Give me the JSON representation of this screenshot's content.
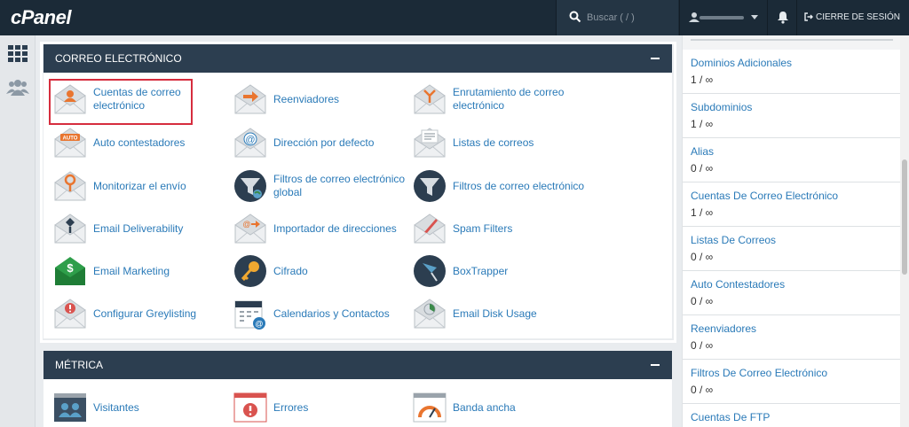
{
  "topbar": {
    "logo": "cPanel",
    "search_placeholder": "Buscar ( / )",
    "logout_label": "CIERRE DE SESIÓN"
  },
  "email_section": {
    "title": "CORREO ELECTRÓNICO",
    "items": [
      {
        "label_lines": [
          "Cuentas de correo",
          "electrónico"
        ],
        "icon": "email-accounts-icon"
      },
      {
        "label_lines": [
          "Reenviadores"
        ],
        "icon": "forwarders-icon"
      },
      {
        "label_lines": [
          "Enrutamiento de correo",
          "electrónico"
        ],
        "icon": "email-routing-icon"
      },
      {
        "label_lines": [
          "Auto contestadores"
        ],
        "icon": "autoresponders-icon"
      },
      {
        "label_lines": [
          "Dirección por defecto"
        ],
        "icon": "default-address-icon"
      },
      {
        "label_lines": [
          "Listas de correos"
        ],
        "icon": "mailing-lists-icon"
      },
      {
        "label_lines": [
          "Monitorizar el envío"
        ],
        "icon": "track-delivery-icon"
      },
      {
        "label_lines": [
          "Filtros de correo electrónico",
          "global"
        ],
        "icon": "global-email-filters-icon"
      },
      {
        "label_lines": [
          "Filtros de correo electrónico"
        ],
        "icon": "email-filters-icon"
      },
      {
        "label_lines": [
          "Email Deliverability"
        ],
        "icon": "email-deliverability-icon"
      },
      {
        "label_lines": [
          "Importador de direcciones"
        ],
        "icon": "address-importer-icon"
      },
      {
        "label_lines": [
          "Spam Filters"
        ],
        "icon": "spam-filters-icon"
      },
      {
        "label_lines": [
          "Email Marketing"
        ],
        "icon": "email-marketing-icon"
      },
      {
        "label_lines": [
          "Cifrado"
        ],
        "icon": "encryption-icon"
      },
      {
        "label_lines": [
          "BoxTrapper"
        ],
        "icon": "boxtrapper-icon"
      },
      {
        "label_lines": [
          "Configurar Greylisting"
        ],
        "icon": "greylisting-icon"
      },
      {
        "label_lines": [
          "Calendarios y Contactos"
        ],
        "icon": "calendars-contacts-icon"
      },
      {
        "label_lines": [
          "Email Disk Usage"
        ],
        "icon": "email-disk-usage-icon"
      }
    ]
  },
  "metrics_section": {
    "title": "MÉTRICA",
    "items": [
      {
        "label": "Visitantes",
        "icon": "visitors-icon"
      },
      {
        "label": "Errores",
        "icon": "errors-icon"
      },
      {
        "label": "Banda ancha",
        "icon": "bandwidth-icon"
      }
    ]
  },
  "stats": [
    {
      "label": "Dominios Adicionales",
      "value": "1 / ∞"
    },
    {
      "label": "Subdominios",
      "value": "1 / ∞"
    },
    {
      "label": "Alias",
      "value": "0 / ∞"
    },
    {
      "label": "Cuentas De Correo Electrónico",
      "value": "1 / ∞"
    },
    {
      "label": "Listas De Correos",
      "value": "0 / ∞"
    },
    {
      "label": "Auto Contestadores",
      "value": "0 / ∞"
    },
    {
      "label": "Reenviadores",
      "value": "0 / ∞"
    },
    {
      "label": "Filtros De Correo Electrónico",
      "value": "0 / ∞"
    },
    {
      "label": "Cuentas De FTP",
      "value": ""
    }
  ]
}
